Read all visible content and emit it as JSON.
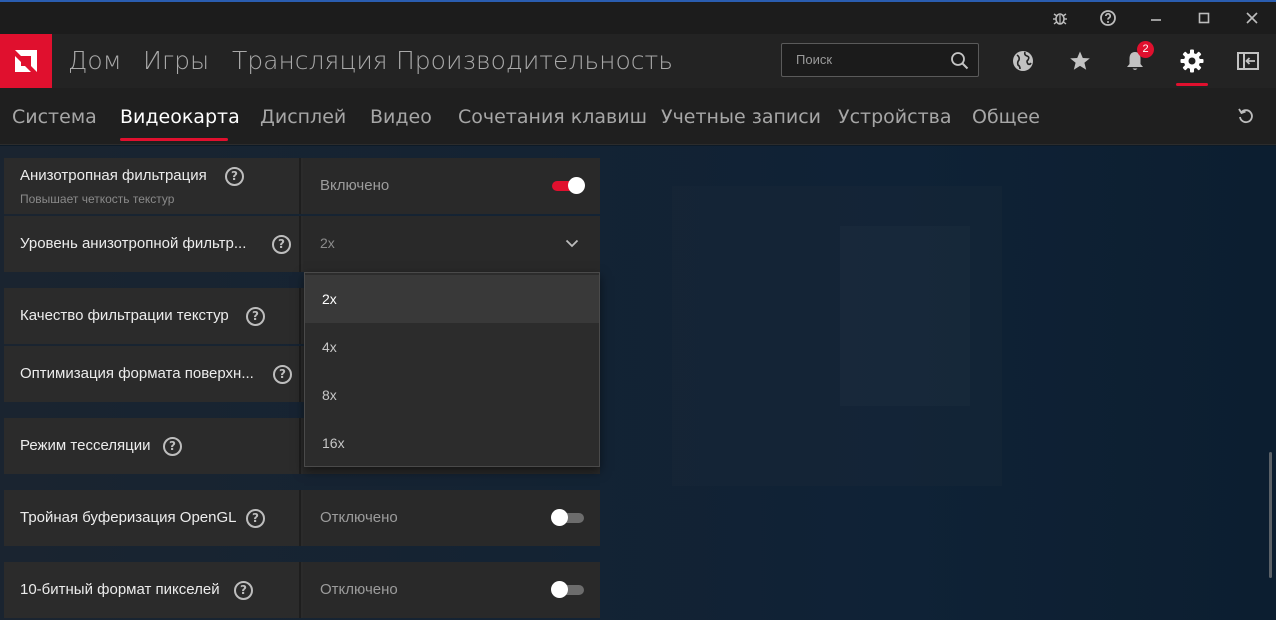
{
  "window": {
    "controls": [
      "bug-icon",
      "help-icon",
      "minimize-icon",
      "maximize-icon",
      "close-icon"
    ]
  },
  "nav": {
    "items": [
      "Дом",
      "Игры",
      "Трансляция",
      "Производительность"
    ],
    "search_placeholder": "Поиск",
    "notification_count": "2",
    "accent": "#e0102e"
  },
  "subnav": {
    "items": [
      "Система",
      "Видеокарта",
      "Дисплей",
      "Видео",
      "Сочетания клавиш",
      "Учетные записи",
      "Устройства",
      "Общее"
    ],
    "active": "Видеокарта"
  },
  "settings": [
    {
      "label": "Анизотропная фильтрация",
      "sublabel": "Повышает четкость текстур",
      "value": "Включено",
      "toggle": true
    },
    {
      "label": "Уровень анизотропной фильтр...",
      "value": "2x"
    },
    {
      "label": "Качество фильтрации текстур"
    },
    {
      "label": "Оптимизация формата поверхн..."
    },
    {
      "label": "Режим тесселяции"
    },
    {
      "label": "Тройная буферизация OpenGL",
      "value": "Отключено",
      "toggle": false
    },
    {
      "label": "10-битный формат пикселей",
      "value": "Отключено",
      "toggle": false
    }
  ],
  "dropdown": {
    "options": [
      "2x",
      "4x",
      "8x",
      "16x"
    ],
    "selected": "2x"
  }
}
